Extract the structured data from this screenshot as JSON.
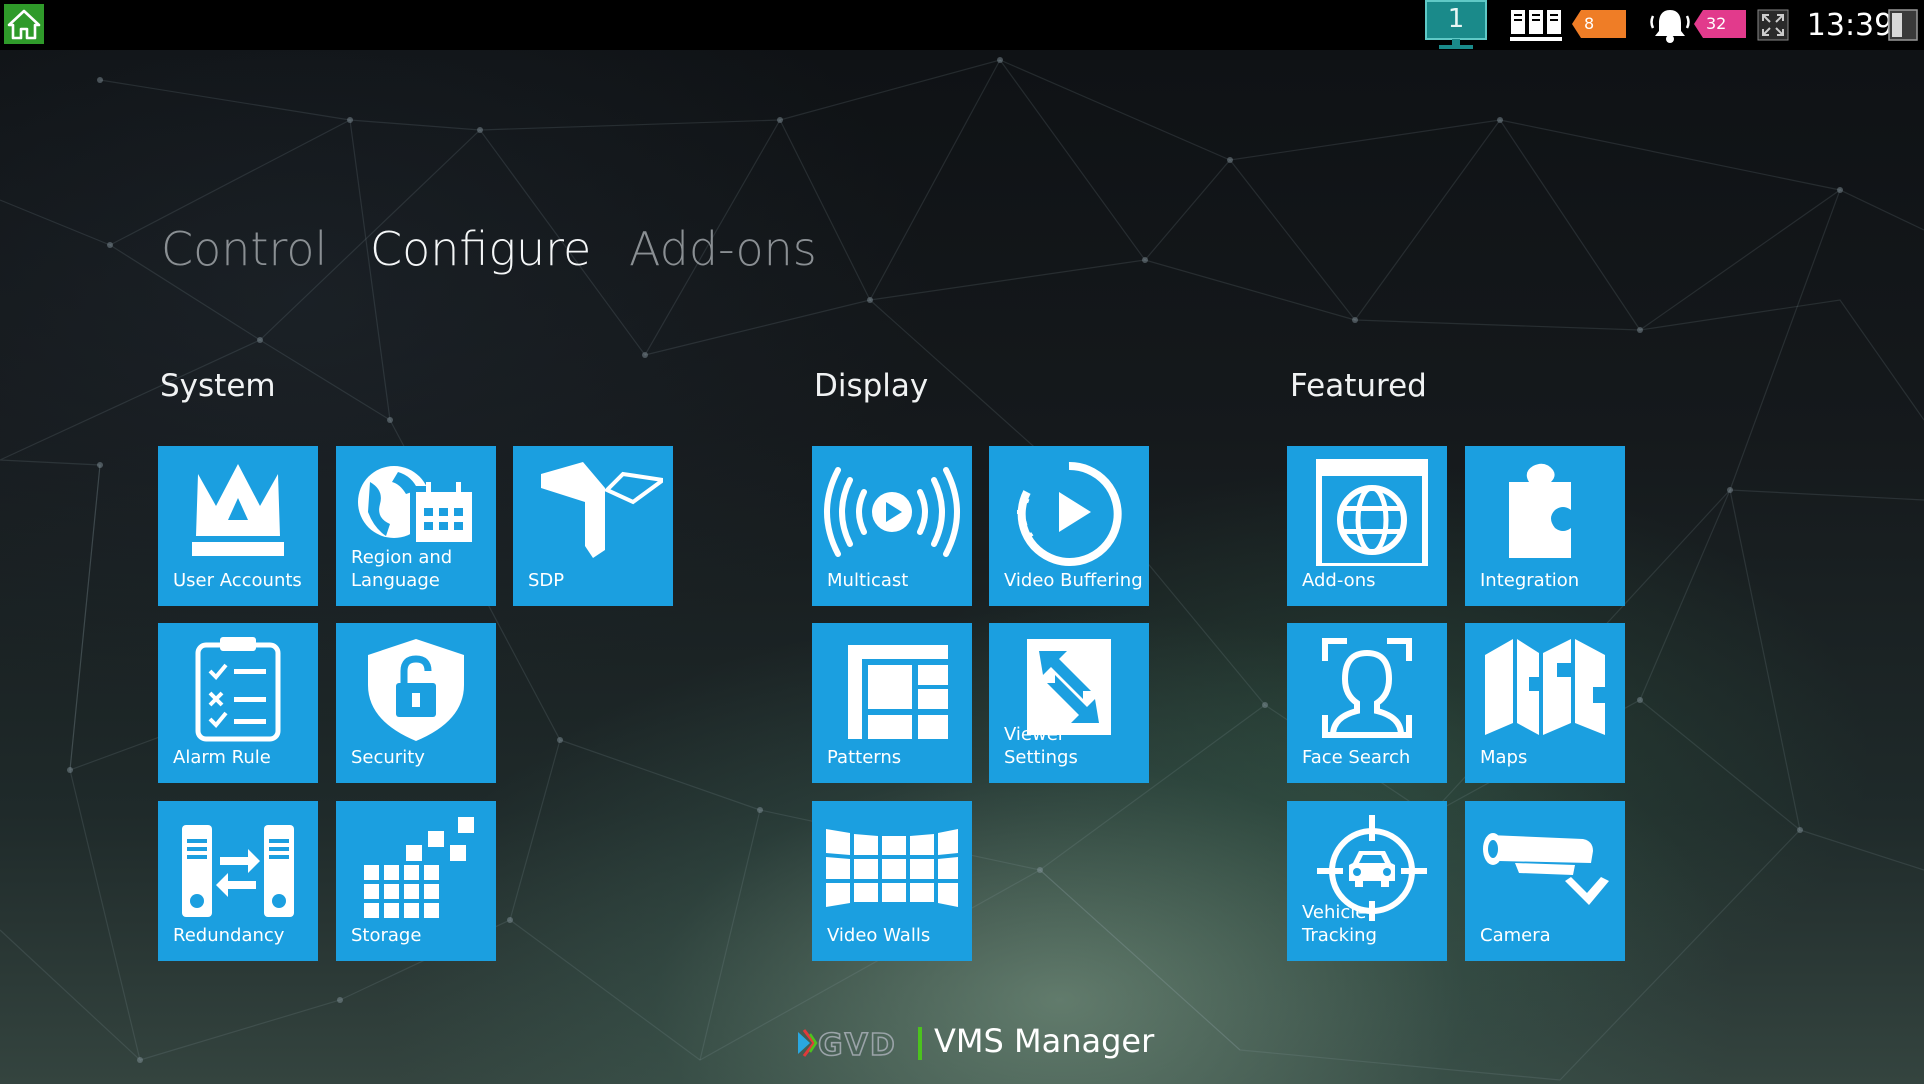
{
  "topbar": {
    "monitor_number": "1",
    "servers_badge": "8",
    "alarms_badge": "32",
    "clock": "13:39"
  },
  "tabs": [
    {
      "label": "Control",
      "active": false
    },
    {
      "label": "Configure",
      "active": true
    },
    {
      "label": "Add-ons",
      "active": false
    }
  ],
  "sections": {
    "system": {
      "title": "System",
      "tiles": [
        {
          "label": "User Accounts",
          "icon": "crown-icon"
        },
        {
          "label": "Region and Language",
          "icon": "globe-calendar-icon"
        },
        {
          "label": "SDP",
          "icon": "sdp-icon"
        },
        {
          "label": "Alarm Rule",
          "icon": "checklist-icon"
        },
        {
          "label": "Security",
          "icon": "shield-lock-icon"
        },
        {
          "label": "Redundancy",
          "icon": "server-transfer-icon"
        },
        {
          "label": "Storage",
          "icon": "storage-blocks-icon"
        }
      ]
    },
    "display": {
      "title": "Display",
      "tiles": [
        {
          "label": "Multicast",
          "icon": "broadcast-play-icon"
        },
        {
          "label": "Video Buffering",
          "icon": "buffering-play-icon"
        },
        {
          "label": "Patterns",
          "icon": "grid-pattern-icon"
        },
        {
          "label": "Viewer Settings",
          "icon": "resize-arrows-icon"
        },
        {
          "label": "Video Walls",
          "icon": "video-wall-icon"
        }
      ]
    },
    "featured": {
      "title": "Featured",
      "tiles": [
        {
          "label": "Add-ons",
          "icon": "browser-globe-icon"
        },
        {
          "label": "Integration",
          "icon": "puzzle-icon"
        },
        {
          "label": "Face Search",
          "icon": "face-scan-icon"
        },
        {
          "label": "Maps",
          "icon": "folded-map-icon"
        },
        {
          "label": "Vehicle Tracking",
          "icon": "vehicle-target-icon"
        },
        {
          "label": "Camera",
          "icon": "cctv-camera-icon"
        }
      ]
    }
  },
  "footer": {
    "brand_logo": "GVD",
    "app_name": "VMS Manager"
  },
  "colors": {
    "tile_blue": "#1b9fe0",
    "home_green": "#2f9a2a",
    "badge_orange": "#ef7d26",
    "badge_pink": "#e23a8c",
    "accent_green": "#4cc21e",
    "monitor_teal": "#1a8a8a"
  }
}
